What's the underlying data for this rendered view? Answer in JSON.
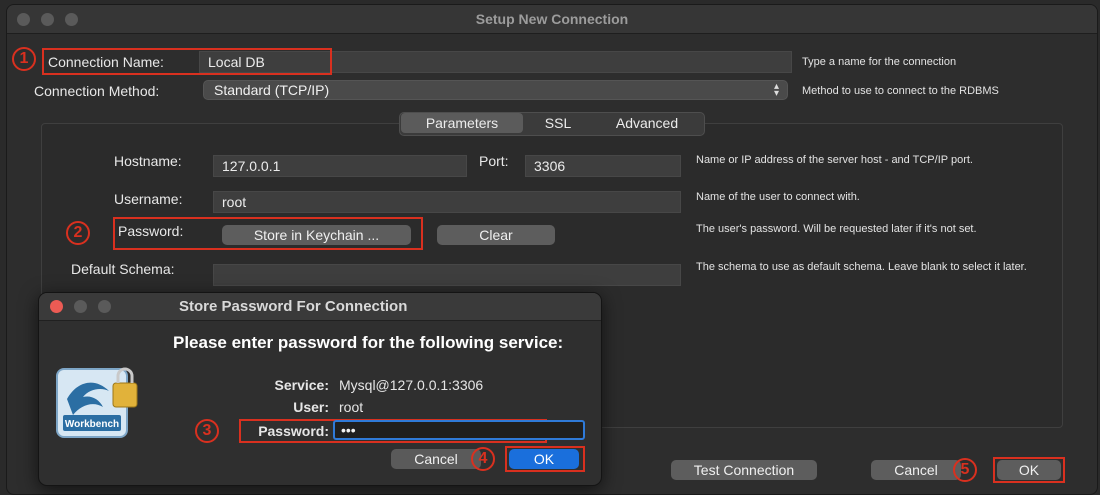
{
  "window": {
    "title": "Setup New Connection"
  },
  "connection_name": {
    "label": "Connection Name:",
    "value": "Local DB",
    "hint": "Type a name for the connection"
  },
  "connection_method": {
    "label": "Connection Method:",
    "value": "Standard (TCP/IP)",
    "hint": "Method to use to connect to the RDBMS"
  },
  "tabs": [
    {
      "label": "Parameters"
    },
    {
      "label": "SSL"
    },
    {
      "label": "Advanced"
    }
  ],
  "params": {
    "hostname": {
      "label": "Hostname:",
      "value": "127.0.0.1"
    },
    "port": {
      "label": "Port:",
      "value": "3306"
    },
    "host_hint": "Name or IP address of the server host - and TCP/IP port.",
    "username": {
      "label": "Username:",
      "value": "root",
      "hint": "Name of the user to connect with."
    },
    "password": {
      "label": "Password:",
      "store_button": "Store in Keychain ...",
      "clear_button": "Clear",
      "hint": "The user's password. Will be requested later if it's not set."
    },
    "schema": {
      "label": "Default Schema:",
      "value": "",
      "hint": "The schema to use as default schema. Leave blank to select it later."
    }
  },
  "footer": {
    "test_button": "Test Connection",
    "cancel_button": "Cancel",
    "ok_button": "OK"
  },
  "dialog": {
    "title": "Store Password For Connection",
    "heading": "Please enter password for the following service:",
    "service_label": "Service:",
    "service_value": "Mysql@127.0.0.1:3306",
    "user_label": "User:",
    "user_value": "root",
    "password_label": "Password:",
    "password_value": "•••",
    "cancel_button": "Cancel",
    "ok_button": "OK",
    "logo_text": "MySQL Workbench"
  },
  "annotations": [
    "1",
    "2",
    "3",
    "4",
    "5"
  ],
  "colors": {
    "highlight": "#d9301f",
    "accent": "#1a6fdc",
    "background": "#2d2d2d"
  },
  "icons": [
    "mysql-workbench-logo-icon",
    "padlock-icon",
    "stepper-icon"
  ]
}
